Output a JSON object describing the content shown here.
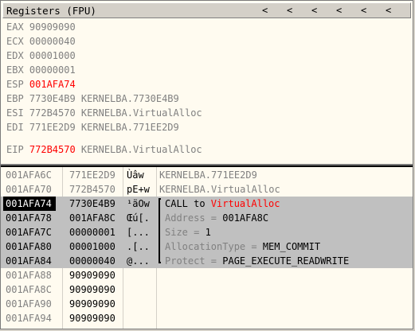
{
  "registers": {
    "title": "Registers (FPU)",
    "arrows": [
      "<",
      "<",
      "<",
      "<",
      "<",
      "<"
    ],
    "rows": [
      {
        "name": "EAX",
        "value": "90909090",
        "comment": "",
        "highlight": false
      },
      {
        "name": "ECX",
        "value": "00000040",
        "comment": "",
        "highlight": false
      },
      {
        "name": "EDX",
        "value": "00001000",
        "comment": "",
        "highlight": false
      },
      {
        "name": "EBX",
        "value": "00000001",
        "comment": "",
        "highlight": false
      },
      {
        "name": "ESP",
        "value": "001AFA74",
        "comment": "",
        "highlight": true
      },
      {
        "name": "EBP",
        "value": "7730E4B9",
        "comment": "KERNELBA.7730E4B9",
        "highlight": false
      },
      {
        "name": "ESI",
        "value": "772B4570",
        "comment": "KERNELBA.VirtualAlloc",
        "highlight": false
      },
      {
        "name": "EDI",
        "value": "771EE2D9",
        "comment": "KERNELBA.771EE2D9",
        "highlight": false
      }
    ],
    "eip": {
      "name": "EIP",
      "value": "772B4570",
      "comment": "KERNELBA.VirtualAlloc",
      "highlight": true
    }
  },
  "stack": {
    "rows": [
      {
        "addr": "001AFA6C",
        "hex": "771EE2D9",
        "ascii": "Ùâw",
        "comment": "KERNELBA.771EE2D9",
        "selected": false,
        "current": false
      },
      {
        "addr": "001AFA70",
        "hex": "772B4570",
        "ascii": "pE+w",
        "comment": "KERNELBA.VirtualAlloc",
        "selected": false,
        "current": false
      },
      {
        "addr": "001AFA74",
        "hex": "7730E4B9",
        "ascii": "¹äOw",
        "comment_prefix": "CALL to ",
        "comment_red": "VirtualAlloc",
        "selected": true,
        "current": true
      },
      {
        "addr": "001AFA78",
        "hex": "001AFA8C",
        "ascii": "Œú[.",
        "comment_label": "Address = ",
        "comment_value": "001AFA8C",
        "selected": true,
        "current": false
      },
      {
        "addr": "001AFA7C",
        "hex": "00000001",
        "ascii": "[...",
        "comment_label": "Size = ",
        "comment_value": "1",
        "selected": true,
        "current": false
      },
      {
        "addr": "001AFA80",
        "hex": "00001000",
        "ascii": ".[..",
        "comment_label": "AllocationType = ",
        "comment_value": "MEM_COMMIT",
        "selected": true,
        "current": false
      },
      {
        "addr": "001AFA84",
        "hex": "00000040",
        "ascii": "@...",
        "comment_label": "Protect = ",
        "comment_value": "PAGE_EXECUTE_READWRITE",
        "selected": true,
        "current": false
      },
      {
        "addr": "001AFA88",
        "hex": "90909090",
        "ascii": "",
        "comment": "",
        "selected": false,
        "current": false
      },
      {
        "addr": "001AFA8C",
        "hex": "90909090",
        "ascii": "",
        "comment": "",
        "selected": false,
        "current": false
      },
      {
        "addr": "001AFA90",
        "hex": "90909090",
        "ascii": "",
        "comment": "",
        "selected": false,
        "current": false
      },
      {
        "addr": "001AFA94",
        "hex": "90909090",
        "ascii": "",
        "comment": "",
        "selected": false,
        "current": false
      }
    ]
  },
  "colors": {
    "highlight": "#ff0000",
    "panel_bg": "#fffbf0",
    "selection": "#c0c0c0",
    "text_gray": "#808080"
  }
}
